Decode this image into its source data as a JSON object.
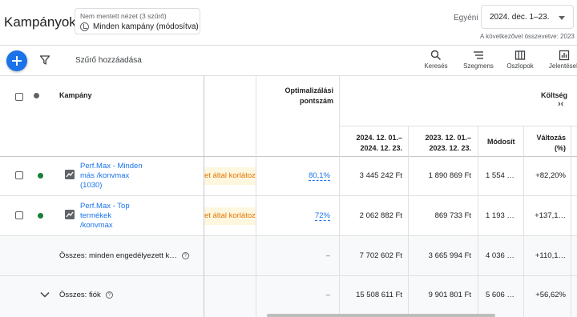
{
  "header": {
    "title": "Kampányok",
    "view_small": "Nem mentett nézet (3 szűrő)",
    "view_main": "Minden kampány (módosítva)",
    "date_label": "Egyéni",
    "date_range": "2024. dec. 1–23.",
    "compare_note": "A következővel összevetve: 2023"
  },
  "toolbar": {
    "add_filter": "Szűrő hozzáadása",
    "search": "Keresés",
    "segment": "Szegmens",
    "columns": "Oszlopok",
    "reports": "Jelentések"
  },
  "table": {
    "col_campaign": "Kampány",
    "col_opt_1": "Optimalizálási",
    "col_opt_2": "pontszám",
    "col_cost": "Költség",
    "col_cost_arrows": "›‹",
    "sub_period_1a": "2024. 12. 01.–",
    "sub_period_1b": "2024. 12. 23.",
    "sub_period_2a": "2023. 12. 01.–",
    "sub_period_2b": "2023. 12. 23.",
    "sub_change": "Módosít",
    "sub_change_pct_1": "Változás",
    "sub_change_pct_2": "(%)",
    "rows": [
      {
        "name_1": "Perf.Max - Minden",
        "name_2": "más /konvmax",
        "name_3": "(1030)",
        "status": "et által korlátoz",
        "opt": "80,1%",
        "v2024": "3 445 242 Ft",
        "v2023": "1 890 869 Ft",
        "change": "1 554 …",
        "pct": "+82,20%"
      },
      {
        "name_1": "Perf.Max - Top",
        "name_2": "termékek",
        "name_3": "/konvmax",
        "status": "et által korlátoz",
        "opt": "72%",
        "v2024": "2 062 882 Ft",
        "v2023": "869 733 Ft",
        "change": "1 193 …",
        "pct": "+137,1…"
      }
    ],
    "total_enabled": {
      "label": "Összes: minden engedélyezett k…",
      "opt": "–",
      "v2024": "7 702 602 Ft",
      "v2023": "3 665 994 Ft",
      "change": "4 036 …",
      "pct": "+110,1…"
    },
    "total_account": {
      "label": "Összes: fiók",
      "opt": "–",
      "v2024": "15 508 611 Ft",
      "v2023": "9 901 801 Ft",
      "change": "5 606 …",
      "pct": "+56,62%"
    },
    "help_glyph": "?"
  },
  "colors": {
    "accent": "#1a73e8",
    "enabled": "#188038",
    "limited_text": "#e37400",
    "limited_bg": "#fef7e0"
  }
}
